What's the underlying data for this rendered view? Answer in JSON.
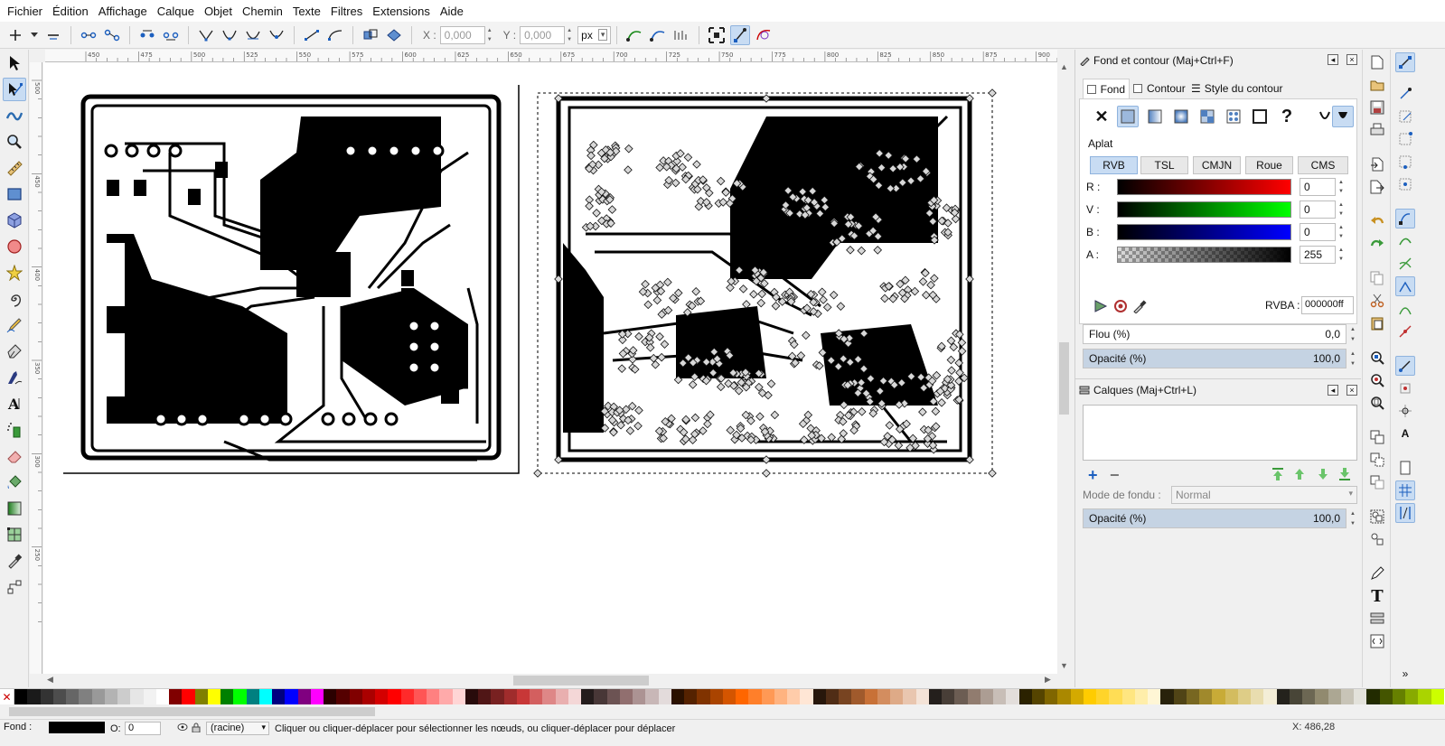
{
  "menu": [
    "Fichier",
    "Édition",
    "Affichage",
    "Calque",
    "Objet",
    "Chemin",
    "Texte",
    "Filtres",
    "Extensions",
    "Aide"
  ],
  "controls": {
    "x_label": "X :",
    "x_value": "0,000",
    "y_label": "Y :",
    "y_value": "0,000",
    "unit": "px"
  },
  "ruler_h": [
    "450",
    "475",
    "500",
    "525",
    "550",
    "575",
    "600",
    "625",
    "650",
    "675",
    "700",
    "725",
    "750",
    "775",
    "800",
    "825",
    "850",
    "875",
    "900"
  ],
  "ruler_v": [
    "500",
    "450",
    "400",
    "350",
    "300",
    "250"
  ],
  "fill_stroke": {
    "title": "Fond et contour (Maj+Ctrl+F)",
    "tabs": [
      "Fond",
      "Contour",
      "Style du contour"
    ],
    "active_tab": "Fond",
    "paint_type": "Aplat",
    "modes": [
      "RVB",
      "TSL",
      "CMJN",
      "Roue",
      "CMS"
    ],
    "active_mode": "RVB",
    "channels": [
      {
        "key": "R",
        "label": "R :",
        "value": "0",
        "color": "#ff0000"
      },
      {
        "key": "V",
        "label": "V :",
        "value": "0",
        "color": "#00ff00"
      },
      {
        "key": "B",
        "label": "B :",
        "value": "0",
        "color": "#0000ff"
      },
      {
        "key": "A",
        "label": "A :",
        "value": "255",
        "color": "#000000"
      }
    ],
    "rgba_label": "RVBA :",
    "rgba_value": "000000ff",
    "blur_label": "Flou (%)",
    "blur_value": "0,0",
    "opacity_label": "Opacité (%)",
    "opacity_value": "100,0"
  },
  "layers": {
    "title": "Calques (Maj+Ctrl+L)",
    "blend_label": "Mode de fondu :",
    "blend_value": "Normal",
    "opacity_label": "Opacité (%)",
    "opacity_value": "100,0"
  },
  "status": {
    "fill_label": "Fond :",
    "opacity_prefix": "O:",
    "opacity_value": "0",
    "layer": "(racine)",
    "message": "Cliquer ou cliquer-déplacer pour sélectionner les nœuds, ou cliquer-déplacer pour déplacer",
    "coords": "X: 486,28"
  },
  "palette": [
    "#000000",
    "#1a1a1a",
    "#333333",
    "#4d4d4d",
    "#666666",
    "#808080",
    "#999999",
    "#b3b3b3",
    "#cccccc",
    "#e6e6e6",
    "#f2f2f2",
    "#ffffff",
    "#800000",
    "#ff0000",
    "#808000",
    "#ffff00",
    "#008000",
    "#00ff00",
    "#008080",
    "#00ffff",
    "#000080",
    "#0000ff",
    "#800080",
    "#ff00ff",
    "#2b0000",
    "#550000",
    "#800000",
    "#aa0000",
    "#d40000",
    "#ff0000",
    "#ff2a2a",
    "#ff5555",
    "#ff8080",
    "#ffaaaa",
    "#ffd5d5",
    "#280b0b",
    "#501616",
    "#782121",
    "#a02c2c",
    "#c83737",
    "#d35f5f",
    "#de8787",
    "#e9afaf",
    "#f4d7d7",
    "#241c1c",
    "#483737",
    "#6c5353",
    "#916f6f",
    "#ac9393",
    "#c8b7b7",
    "#e3dbdb",
    "#2b1100",
    "#552200",
    "#803300",
    "#aa4400",
    "#d45500",
    "#ff6600",
    "#ff7f2a",
    "#ff9955",
    "#ffb380",
    "#ffccaa",
    "#ffe6d5",
    "#28170b",
    "#502d16",
    "#784421",
    "#a05a2c",
    "#c87137",
    "#d38d5f",
    "#deaa87",
    "#e9c6af",
    "#f4e3d7",
    "#241f1c",
    "#483e37",
    "#6c5d53",
    "#917c6f",
    "#ac9d93",
    "#c8beb7",
    "#e3dedb",
    "#2b2200",
    "#554400",
    "#806600",
    "#aa8800",
    "#d4aa00",
    "#ffcc00",
    "#ffd42a",
    "#ffdd55",
    "#ffe680",
    "#ffeeaa",
    "#fff6d5",
    "#28220b",
    "#504416",
    "#786721",
    "#a0892c",
    "#c8ab37",
    "#d3bc5f",
    "#decd87",
    "#e9ddaf",
    "#f4eed7",
    "#24221c",
    "#484537",
    "#6c6753",
    "#918a6f",
    "#aca793",
    "#c8c4b7",
    "#e3e2db",
    "#222b00",
    "#445500",
    "#668000",
    "#88aa00",
    "#aad400",
    "#ccff00"
  ]
}
